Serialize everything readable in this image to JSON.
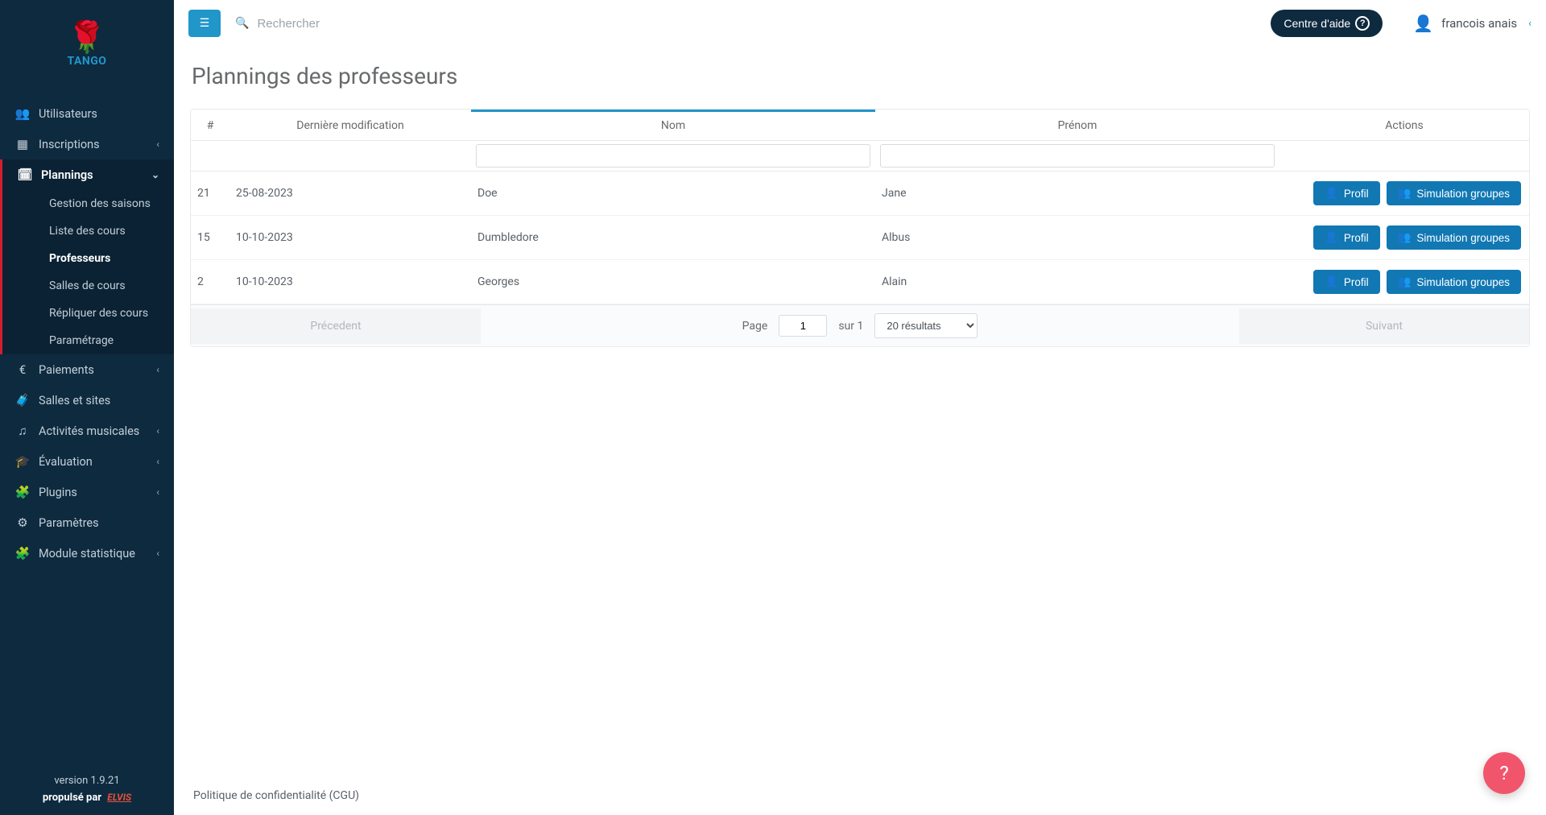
{
  "brand": {
    "name": "TANGO",
    "logo_emoji": "🌹"
  },
  "topbar": {
    "search_placeholder": "Rechercher",
    "help_label": "Centre d'aide",
    "user_name": "francois anais"
  },
  "sidebar": {
    "items": [
      {
        "icon": "users",
        "label": "Utilisateurs",
        "expandable": false
      },
      {
        "icon": "table",
        "label": "Inscriptions",
        "expandable": true
      },
      {
        "icon": "calendar",
        "label": "Plannings",
        "expandable": true,
        "active": true,
        "children": [
          {
            "label": "Gestion des saisons"
          },
          {
            "label": "Liste des cours"
          },
          {
            "label": "Professeurs",
            "selected": true
          },
          {
            "label": "Salles de cours"
          },
          {
            "label": "Répliquer des cours"
          },
          {
            "label": "Paramétrage"
          }
        ]
      },
      {
        "icon": "euro",
        "label": "Paiements",
        "expandable": true
      },
      {
        "icon": "briefcase",
        "label": "Salles et sites",
        "expandable": false
      },
      {
        "icon": "music",
        "label": "Activités musicales",
        "expandable": true
      },
      {
        "icon": "grad",
        "label": "Évaluation",
        "expandable": true
      },
      {
        "icon": "puzzle",
        "label": "Plugins",
        "expandable": true
      },
      {
        "icon": "gear",
        "label": "Paramètres",
        "expandable": false
      },
      {
        "icon": "puzzle",
        "label": "Module statistique",
        "expandable": true
      }
    ],
    "version": "version 1.9.21",
    "powered_by": "propulsé par",
    "powered_brand": "ELVIS"
  },
  "page": {
    "title": "Plannings des professeurs"
  },
  "table": {
    "columns": {
      "id": "#",
      "modified": "Dernière modification",
      "nom": "Nom",
      "prenom": "Prénom",
      "actions": "Actions"
    },
    "actions": {
      "profil": "Profil",
      "simulation": "Simulation groupes"
    },
    "rows": [
      {
        "id": "21",
        "modified": "25-08-2023",
        "nom": "Doe",
        "prenom": "Jane"
      },
      {
        "id": "15",
        "modified": "10-10-2023",
        "nom": "Dumbledore",
        "prenom": "Albus"
      },
      {
        "id": "2",
        "modified": "10-10-2023",
        "nom": "Georges",
        "prenom": "Alain"
      }
    ]
  },
  "pagination": {
    "prev": "Précedent",
    "next": "Suivant",
    "page_label": "Page",
    "page_value": "1",
    "of_label": "sur 1",
    "results_label": "20 résultats"
  },
  "footer": {
    "privacy": "Politique de confidentialité (CGU)"
  },
  "icons": {
    "users": "👥",
    "table": "▦",
    "calendar": "🗓",
    "euro": "€",
    "briefcase": "🧳",
    "music": "♫",
    "grad": "🎓",
    "puzzle": "🧩",
    "gear": "⚙"
  }
}
